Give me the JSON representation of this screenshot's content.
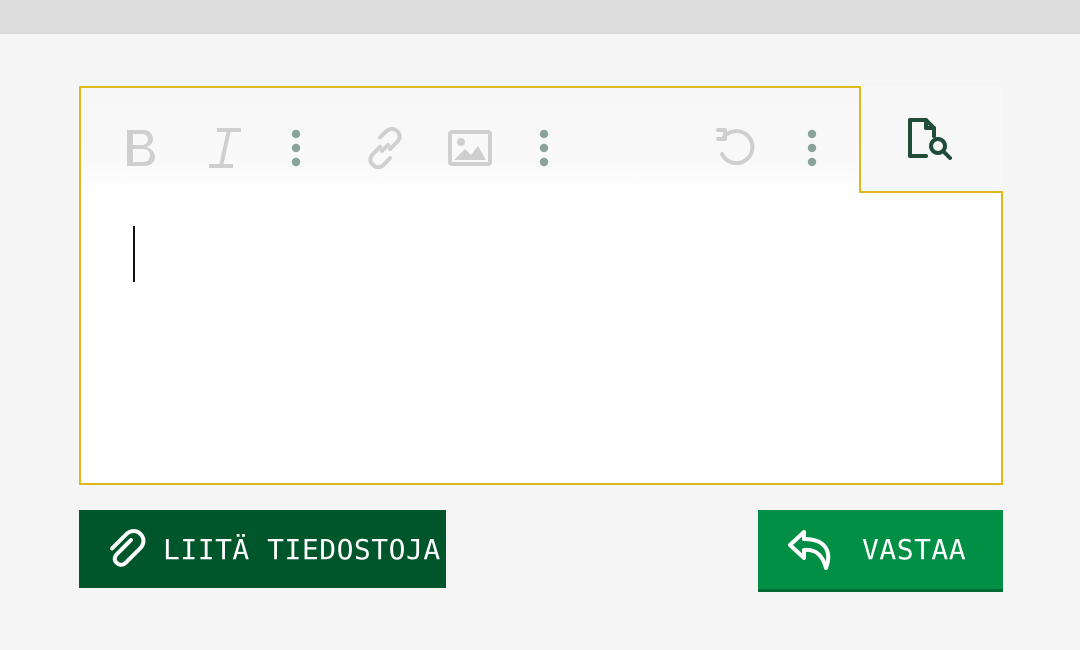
{
  "editor": {
    "toolbar": {
      "bold_icon": "bold-icon",
      "italic_icon": "italic-icon",
      "more_icon": "more-vertical-icon",
      "link_icon": "link-icon",
      "image_icon": "image-icon",
      "undo_icon": "undo-icon",
      "preview_icon": "document-search-icon"
    },
    "content": ""
  },
  "actions": {
    "attach_label": "LIITÄ TIEDOSTOJA",
    "reply_label": "VASTAA"
  },
  "colors": {
    "accent_border": "#e1b91a",
    "attach_bg": "#00562b",
    "reply_bg": "#008f45",
    "icon_disabled": "#cfcfcf",
    "icon_more": "#8aa39a",
    "preview_icon": "#1f4d3a"
  }
}
